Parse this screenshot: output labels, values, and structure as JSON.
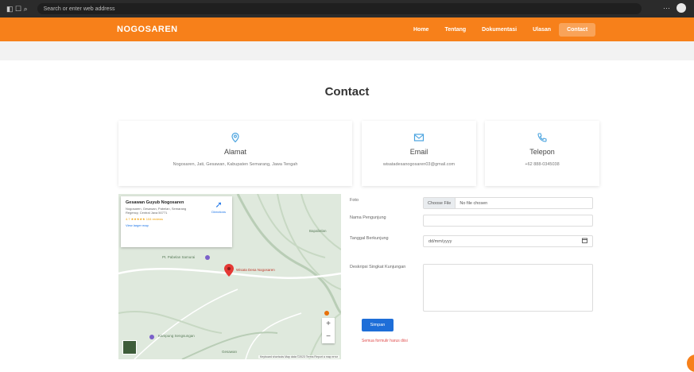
{
  "browser": {
    "address": "Search or enter web address"
  },
  "nav": {
    "brand": "NOGOSAREN",
    "items": [
      {
        "label": "Home"
      },
      {
        "label": "Tentang"
      },
      {
        "label": "Dokumentasi"
      },
      {
        "label": "Ulasan"
      },
      {
        "label": "Contact"
      }
    ]
  },
  "page": {
    "title": "Contact"
  },
  "cards": [
    {
      "label": "Alamat",
      "value": "Nogosaren, Jati, Gesawan, Kabupaten Semarang, Jawa Tengah",
      "icon": "map-pin-icon"
    },
    {
      "label": "Email",
      "value": "wisatadesanogosaren03@gmail.com",
      "icon": "mail-icon"
    },
    {
      "label": "Telepon",
      "value": "+62 888-0345038",
      "icon": "phone-icon"
    }
  ],
  "map": {
    "place_title": "Gesawan Guyub Nogosaren",
    "place_address": "Nogosaren, Gesawan, Pabelan, Semarang Regency, Central Java 50771",
    "rating_text": "4.7 ★★★★★ 104 reviews",
    "larger_map": "View larger map",
    "directions": "Directions",
    "pin_label": "Wisata Desa Nogosaren",
    "place_labels": [
      "Pt. Pabelan Samurai",
      "Bapabelan",
      "Gesawan",
      "Kampung Sengsungan"
    ],
    "attribution": "Keyboard shortcuts  Map data ©2023  Terms  Report a map error"
  },
  "form": {
    "photo_label": "Foto",
    "file_button": "Choose File",
    "file_status": "No file chosen",
    "name_label": "Nama Pengunjung",
    "date_label": "Tanggal Berkunjung",
    "date_placeholder": "dd/mm/yyyy",
    "message_label": "Deskripsi Singkat Kunjungan",
    "submit_label": "Simpan",
    "note": "Semua formulir harus diisi"
  }
}
